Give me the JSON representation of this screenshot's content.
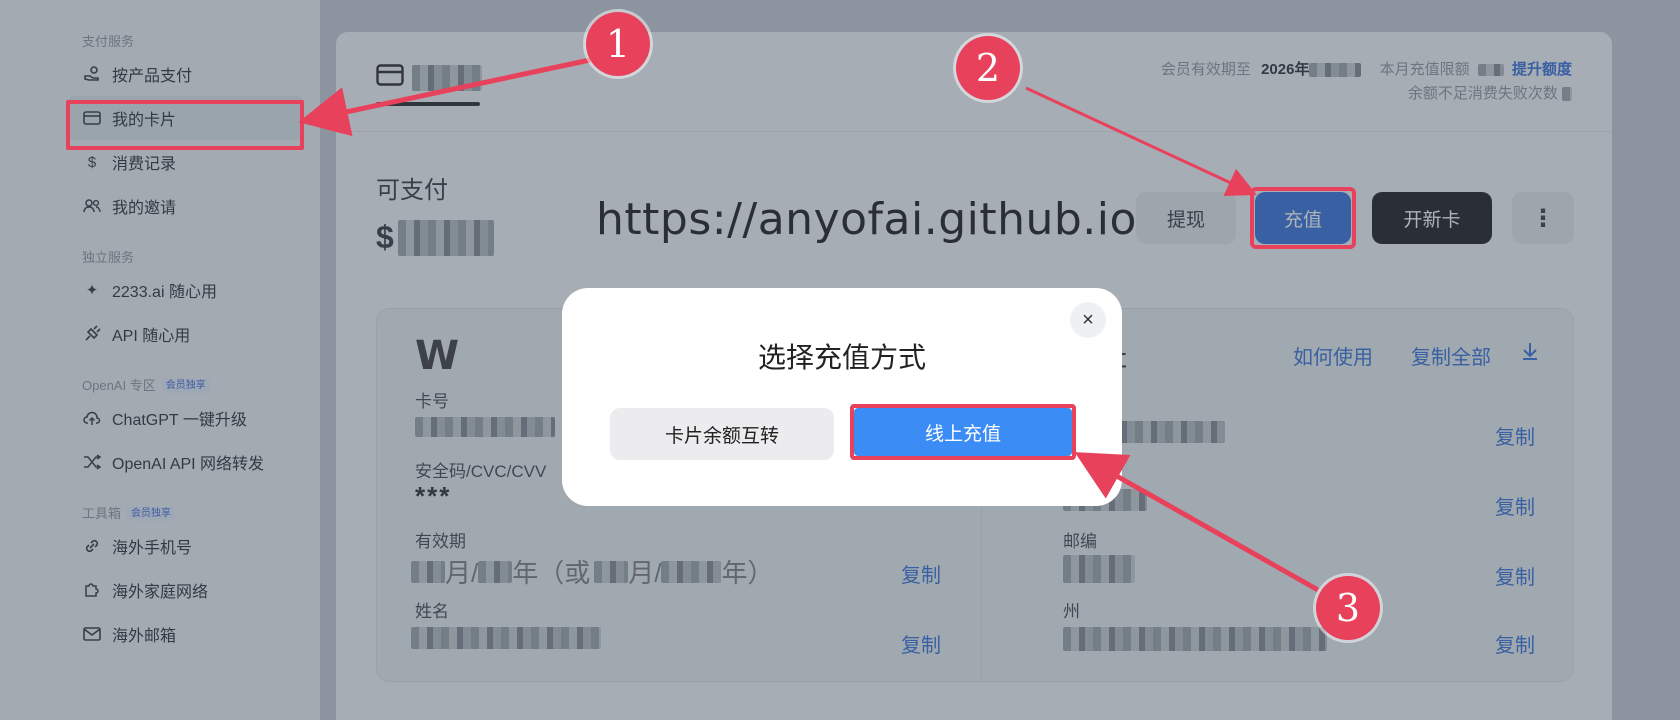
{
  "sidebar": {
    "sections": [
      {
        "title": "支付服务",
        "items": [
          {
            "label": "按产品支付",
            "icon": "hand-coin-icon"
          },
          {
            "label": "我的卡片",
            "icon": "credit-card-icon"
          },
          {
            "label": "消费记录",
            "icon": "dollar-icon"
          },
          {
            "label": "我的邀请",
            "icon": "users-icon"
          }
        ]
      },
      {
        "title": "独立服务",
        "items": [
          {
            "label": "2233.ai 随心用",
            "icon": "sparkle-icon"
          },
          {
            "label": "API 随心用",
            "icon": "plug-icon"
          }
        ]
      },
      {
        "title": "OpenAI 专区",
        "badge": "会员独享",
        "items": [
          {
            "label": "ChatGPT 一键升级",
            "icon": "upload-cloud-icon"
          },
          {
            "label": "OpenAI API 网络转发",
            "icon": "shuffle-icon"
          }
        ]
      },
      {
        "title": "工具箱",
        "badge": "会员独享",
        "items": [
          {
            "label": "海外手机号",
            "icon": "link-icon"
          },
          {
            "label": "海外家庭网络",
            "icon": "puzzle-icon"
          },
          {
            "label": "海外邮箱",
            "icon": "mail-icon"
          }
        ]
      }
    ]
  },
  "header": {
    "member_expiry_label": "会员有效期至",
    "member_expiry_value": "2026年",
    "monthly_limit_label": "本月充值限额",
    "upgrade_link": "提升额度",
    "insufficient_label": "余额不足消费失败次数"
  },
  "balance": {
    "label": "可支付",
    "currency": "$"
  },
  "watermark_url": "https://anyofai.github.io/",
  "actions": {
    "withdraw": "提现",
    "recharge": "充值",
    "new_card": "开新卡",
    "more": "⋮"
  },
  "card": {
    "brand": "W",
    "number_label": "卡号",
    "cvc_label": "安全码/CVC/CVV",
    "cvc_value": "***",
    "expiry_label": "有效期",
    "expiry_month_unit": "月/",
    "expiry_year_unit": "年（或",
    "expiry_year_unit2": "年）",
    "name_label": "姓名",
    "copy": "复制"
  },
  "address": {
    "title": "地址",
    "how_to_use": "如何使用",
    "copy_all": "复制全部",
    "zip_label": "邮编",
    "state_label": "州",
    "copy": "复制"
  },
  "dialog": {
    "title": "选择充值方式",
    "close": "×",
    "option_transfer": "卡片余额互转",
    "option_online": "线上充值"
  },
  "callouts": [
    "1",
    "2",
    "3"
  ],
  "colors": {
    "accent": "#2f6ad8",
    "highlight": "#e8415c",
    "online_button": "#3b8cf4"
  }
}
